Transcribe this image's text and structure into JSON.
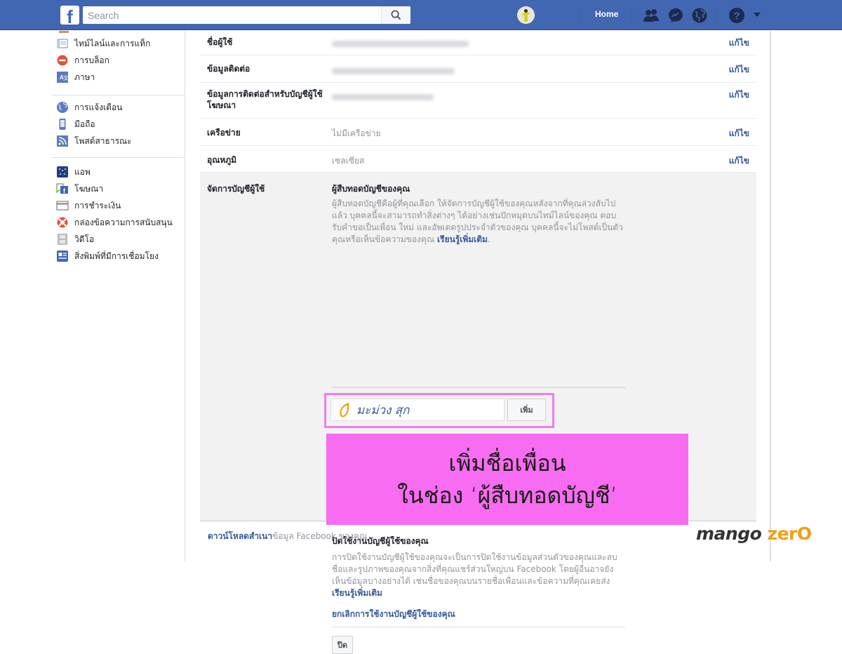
{
  "topbar": {
    "logo": "f",
    "search_placeholder": "Search",
    "home_label": "Home",
    "icons": [
      "friend-requests-icon",
      "messenger-icon",
      "notifications-globe-icon",
      "help-icon",
      "dropdown-caret-icon"
    ]
  },
  "sidebar": {
    "groups": [
      [
        {
          "label": "ไทม์ไลน์และการแท็ก",
          "icon": "timeline-icon"
        },
        {
          "label": "การบล็อก",
          "icon": "block-icon"
        },
        {
          "label": "ภาษา",
          "icon": "language-icon"
        }
      ],
      [
        {
          "label": "การแจ้งเตือน",
          "icon": "globe-icon"
        },
        {
          "label": "มือถือ",
          "icon": "mobile-icon"
        },
        {
          "label": "โพสต์สาธารณะ",
          "icon": "rss-icon"
        }
      ],
      [
        {
          "label": "แอพ",
          "icon": "apps-icon"
        },
        {
          "label": "โฆษณา",
          "icon": "ads-icon"
        },
        {
          "label": "การชำระเงิน",
          "icon": "payment-card-icon"
        },
        {
          "label": "กล่องข้อความการสนับสนุน",
          "icon": "lifebuoy-icon"
        },
        {
          "label": "วิดีโอ",
          "icon": "video-film-icon"
        },
        {
          "label": "สิ่งพิมพ์ที่มีการเชื่อมโยง",
          "icon": "article-icon"
        }
      ]
    ]
  },
  "settings": {
    "edit_label": "แก้ไข",
    "rows": [
      {
        "label": "ชื่อผู้ใช้",
        "value": ""
      },
      {
        "label": "ข้อมูลติดต่อ",
        "value": ""
      },
      {
        "label": "ข้อมูลการติดต่อสำหรับบัญชีผู้ใช้โฆษณา",
        "value": ""
      },
      {
        "label": "เครือข่าย",
        "value": "ไม่มีเครือข่าย"
      },
      {
        "label": "อุณหภูมิ",
        "value": "เซลเซียส"
      }
    ],
    "manage": {
      "label": "จัดการบัญชีผู้ใช้",
      "legacy_title": "ผู้สืบทอดบัญชีของคุณ",
      "legacy_desc": "ผู้สืบทอดบัญชีคือผู้ที่คุณเลือก ให้จัดการบัญชีผู้ใช้ของคุณหลังจากที่คุณล่วงลับไปแล้ว บุคคลนี้จะสามารถทำสิ่งต่างๆ ได้อย่างเช่นปักหมุดบนไทม์ไลน์ของคุณ ตอบรับคำขอเป็นเพื่อน ใหม่ และอัพเดตรูปประจำตัวของคุณ บุคคลนี้จะไม่โพสต์เป็นตัวคุณหรือเห็นข้อความของคุณ",
      "learn_more": "เรียนรู้เพิ่มเติม",
      "legacy_input_value": "มะม่วง สุก",
      "add_button": "เพิ่ม",
      "callout_line1": "เพิ่มชื่อเพื่อน",
      "callout_line2": "ในช่อง ‘ผู้สืบทอดบัญชี’",
      "deactivate_title": "ปิดใช้งานบัญชีผู้ใช้ของคุณ",
      "deactivate_desc": "การปิดใช้งานบัญชีผู้ใช้ของคุณจะเป็นการปิดใช้งานข้อมูลส่วนตัวของคุณและลบชื่อและรูปภาพของคุณจากสิ่งที่คุณแชร์ส่วนใหญ่บน Facebook โดยผู้อื่นอาจยังเห็นข้อมูลบางอย่างได้ เช่นชื่อของคุณบนรายชื่อเพื่อนและข้อความที่คุณเคยส่ง",
      "deactivate_learn_more": "เรียนรู้เพิ่มเติม",
      "deactivate_link": "ยกเลิกการใช้งานบัญชีผู้ใช้ของคุณ",
      "close_button": "ปิด"
    },
    "download_link": "ดาวน์โหลดสำเนา",
    "download_rest": "ข้อมูล Facebook ของคุณ"
  },
  "watermark": {
    "part1": "mango",
    "part2": "zerO"
  },
  "colors": {
    "brand": "#4267b2",
    "link": "#365899",
    "callout": "#f76cf0",
    "highlight_border": "#f27bf2",
    "watermark_orange": "#f0a012"
  }
}
